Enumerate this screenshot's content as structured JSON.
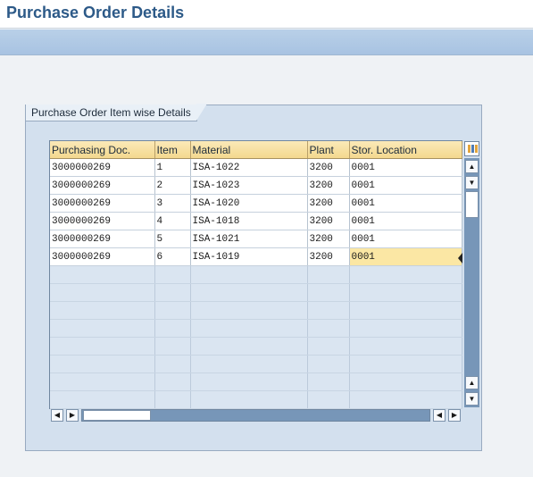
{
  "page": {
    "title": "Purchase Order Details"
  },
  "group": {
    "title": "Purchase Order Item wise Details"
  },
  "table": {
    "columns": [
      "Purchasing Doc.",
      "Item",
      "Material",
      "Plant",
      "Stor. Location"
    ],
    "rows": [
      [
        "3000000269",
        "1",
        "ISA-1022",
        "3200",
        "0001"
      ],
      [
        "3000000269",
        "2",
        "ISA-1023",
        "3200",
        "0001"
      ],
      [
        "3000000269",
        "3",
        "ISA-1020",
        "3200",
        "0001"
      ],
      [
        "3000000269",
        "4",
        "ISA-1018",
        "3200",
        "0001"
      ],
      [
        "3000000269",
        "5",
        "ISA-1021",
        "3200",
        "0001"
      ],
      [
        "3000000269",
        "6",
        "ISA-1019",
        "3200",
        "0001"
      ]
    ],
    "empty_rows": 8,
    "selected_cell": {
      "row": 5,
      "column": 4
    }
  },
  "scroll": {
    "up_glyph": "▲",
    "down_glyph": "▼",
    "left_glyph": "◀",
    "right_glyph": "▶"
  },
  "colors": {
    "title": "#2d5a88",
    "header_fill": "#f3d88e",
    "selected_cell": "#fbe7a4",
    "scrollbar": "#7796b8"
  }
}
